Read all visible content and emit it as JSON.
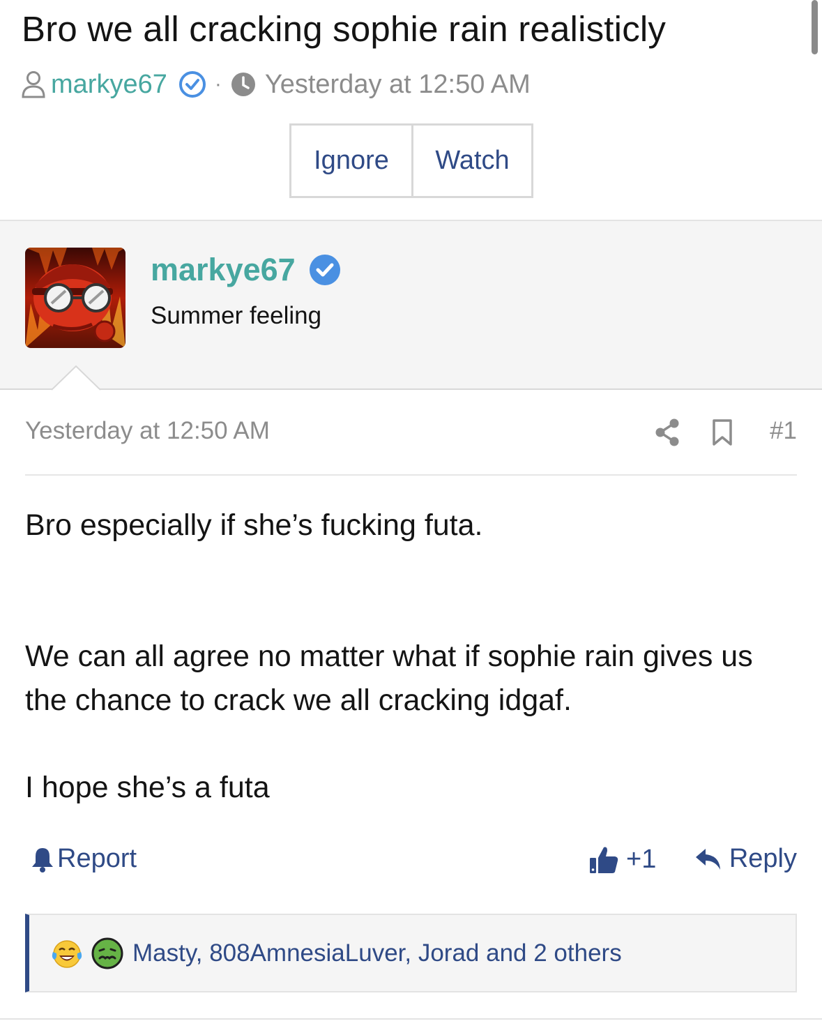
{
  "thread": {
    "title": "Bro we all cracking sophie rain realisticly",
    "author": "markye67",
    "date": "Yesterday at 12:50 AM"
  },
  "buttons": {
    "ignore": "Ignore",
    "watch": "Watch"
  },
  "user": {
    "name": "markye67",
    "title": "Summer feeling"
  },
  "post": {
    "date": "Yesterday at 12:50 AM",
    "number": "#1",
    "paragraphs": [
      "Bro especially if she’s fucking futa.",
      "We can all agree no matter what if sophie rain gives us the chance to crack we all cracking idgaf.",
      "I hope she’s a futa"
    ]
  },
  "actions": {
    "report": "Report",
    "like": "+1",
    "reply": "Reply"
  },
  "reactions": {
    "icons": [
      "laughing-crying-icon",
      "sick-face-icon"
    ],
    "text": "Masty, 808AmnesiaLuver, Jorad and 2 others"
  },
  "colors": {
    "accent_teal": "#47a7a0",
    "link_blue": "#2f4a86",
    "verified_blue": "#4a90e2",
    "muted": "#8c8c8c"
  }
}
